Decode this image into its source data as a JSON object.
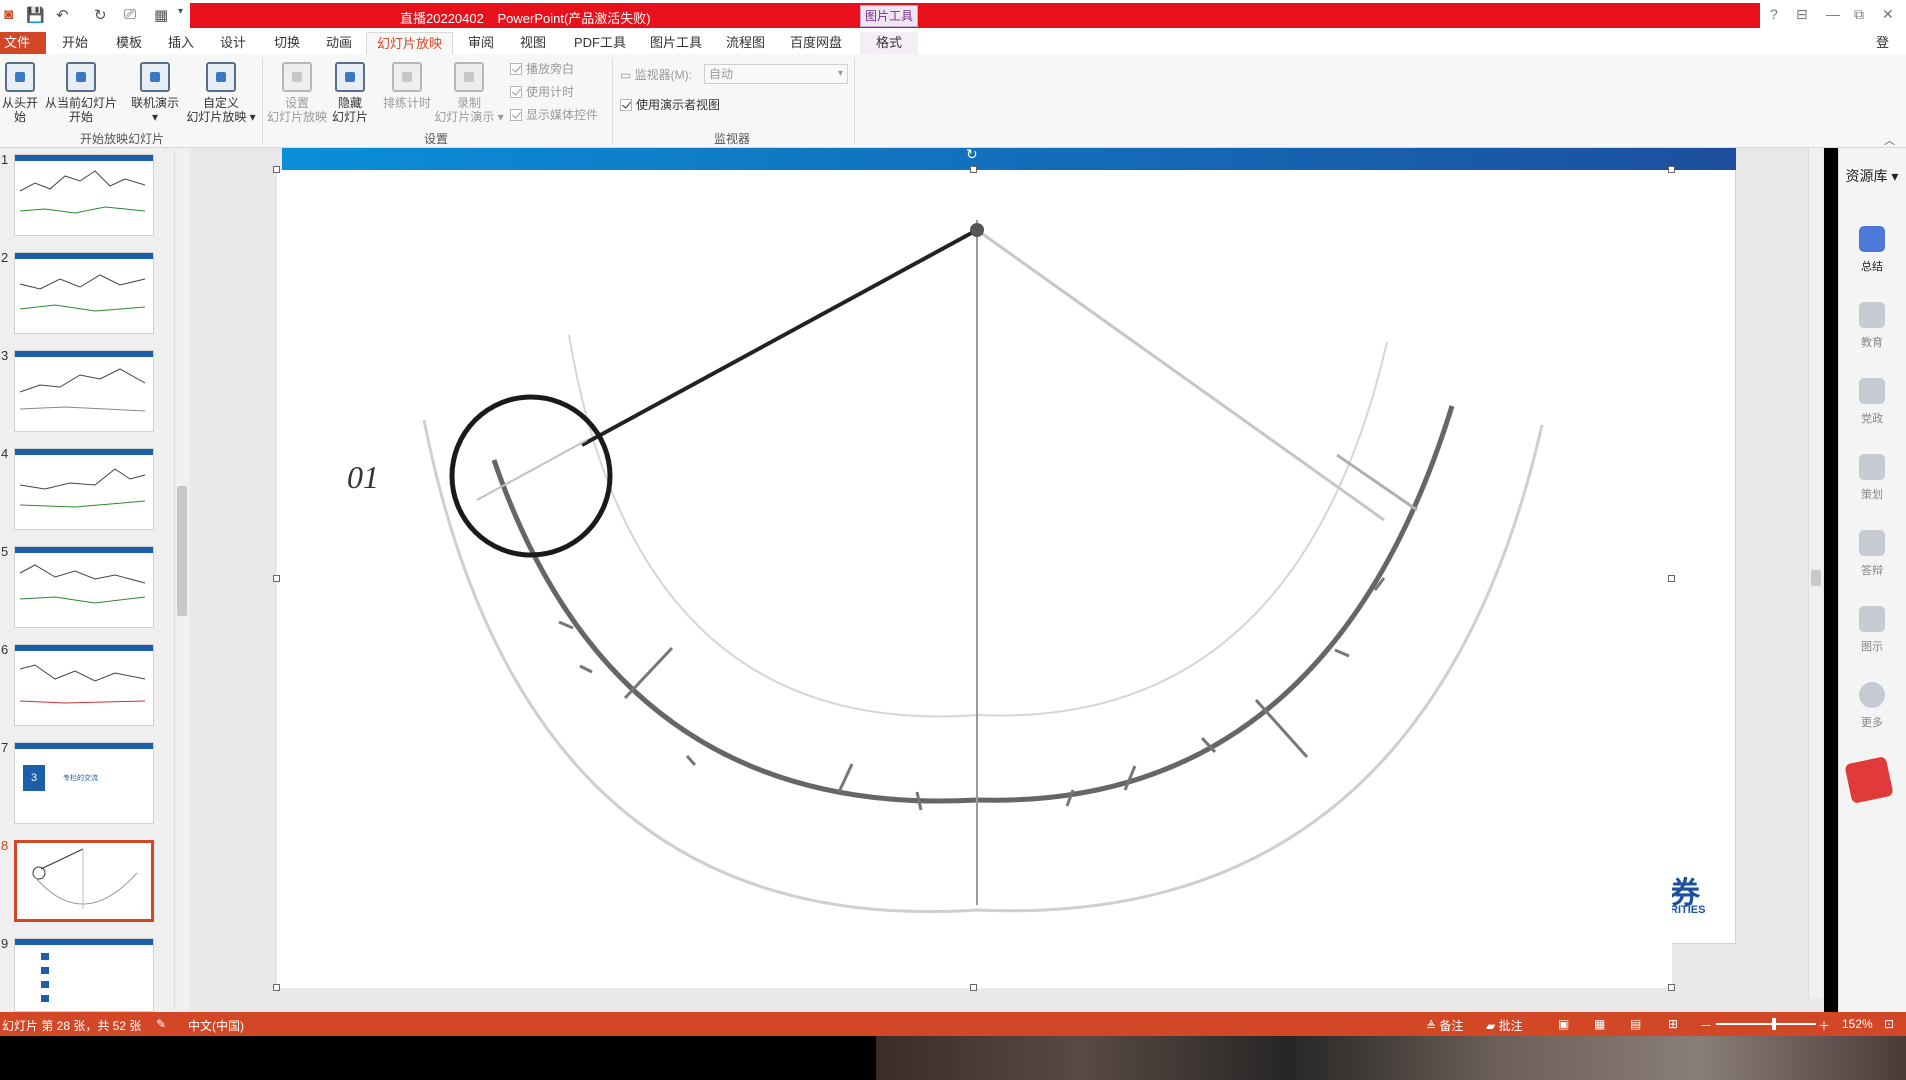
{
  "window": {
    "title_left": "直播20220402",
    "title_right": "PowerPoint(产品激活失败)",
    "context_tab_group": "图片工具",
    "signin": "登录",
    "controls": [
      "?",
      "⊟",
      "—",
      "⧉",
      "✕"
    ]
  },
  "menu": {
    "tabs": [
      "文件",
      "开始",
      "模板",
      "插入",
      "设计",
      "切换",
      "动画",
      "幻灯片放映",
      "审阅",
      "视图",
      "PDF工具",
      "图片工具",
      "流程图",
      "百度网盘",
      "格式"
    ],
    "active": "幻灯片放映"
  },
  "ribbon": {
    "group_start": {
      "label": "开始放映幻灯片",
      "from_beginning": "从头开始",
      "from_current_1": "从当前幻灯片",
      "from_current_2": "开始",
      "online_1": "联机演示",
      "online_2": "▾",
      "custom_1": "自定义",
      "custom_2": "幻灯片放映 ▾"
    },
    "group_setup": {
      "label": "设置",
      "setup_1": "设置",
      "setup_2": "幻灯片放映",
      "hide_1": "隐藏",
      "hide_2": "幻灯片",
      "rehearse": "排练计时",
      "record_1": "录制",
      "record_2": "幻灯片演示 ▾",
      "play_narration": "播放旁白",
      "use_timings": "使用计时",
      "show_media": "显示媒体控件"
    },
    "group_monitors": {
      "label": "监视器",
      "monitor_label": "监视器(M):",
      "monitor_value": "自动",
      "presenter_view": "使用演示者视图"
    }
  },
  "thumbnails": [
    {
      "num": "1"
    },
    {
      "num": "2"
    },
    {
      "num": "3"
    },
    {
      "num": "4"
    },
    {
      "num": "5"
    },
    {
      "num": "6"
    },
    {
      "num": "7",
      "section_num": "3",
      "section_title": "专栏的交流"
    },
    {
      "num": "8"
    },
    {
      "num": "9"
    }
  ],
  "slide": {
    "sketch_label": "01",
    "logo_text_1": "券",
    "logo_text_2": "RITIES"
  },
  "resources": {
    "title": "资源库",
    "items": [
      {
        "label": "总结",
        "icon": "summary-icon"
      },
      {
        "label": "教育",
        "icon": "education-icon"
      },
      {
        "label": "党政",
        "icon": "government-icon"
      },
      {
        "label": "策划",
        "icon": "planning-icon"
      },
      {
        "label": "答辩",
        "icon": "defense-icon"
      },
      {
        "label": "图示",
        "icon": "diagram-icon"
      },
      {
        "label": "更多",
        "icon": "more-icon"
      }
    ]
  },
  "status": {
    "slide_info": "幻灯片 第 28 张，共 52 张",
    "language": "中文(中国)",
    "notes": "备注",
    "comments": "批注",
    "zoom": "152%"
  },
  "colors": {
    "accent": "#d24726",
    "titlebar_red": "#e8111b",
    "slide_blue": "#1c4f9e"
  }
}
